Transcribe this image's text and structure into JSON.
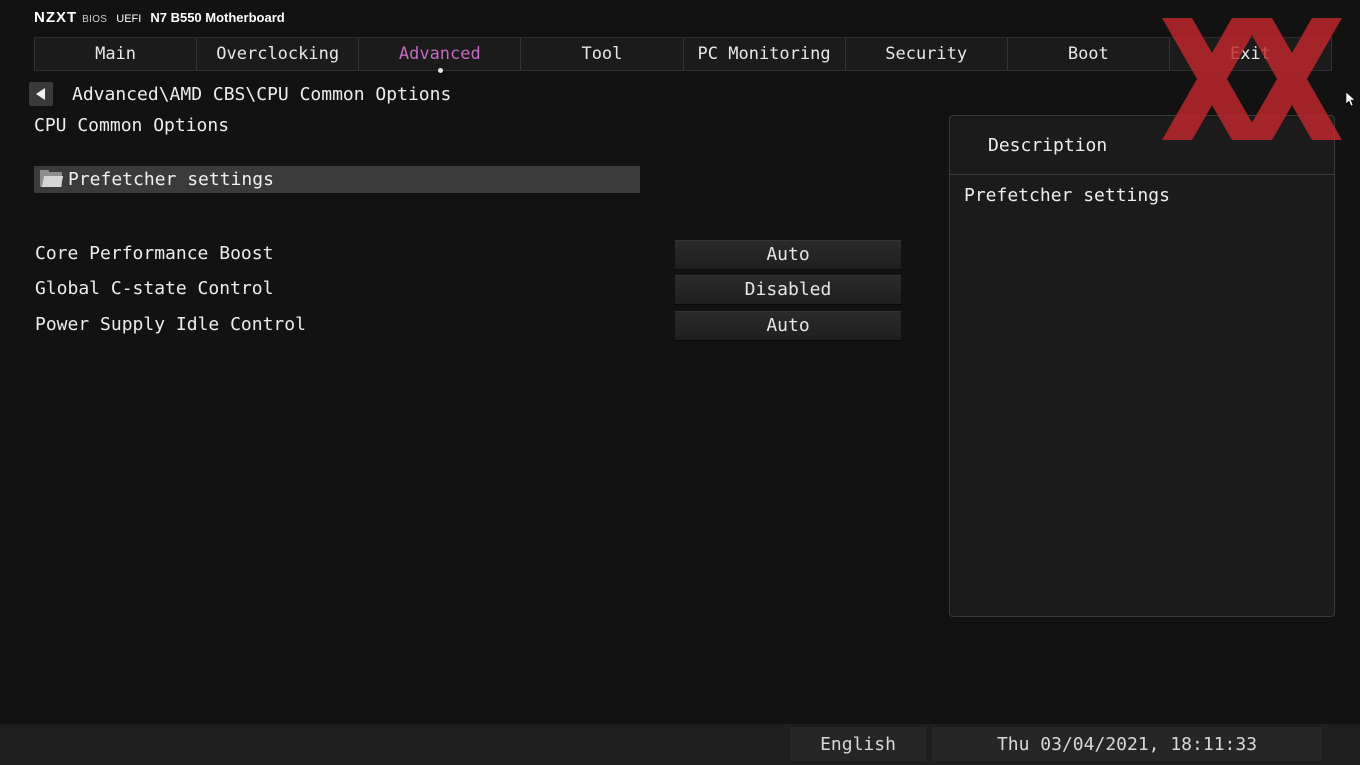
{
  "brand": {
    "logo": "NZXT",
    "bios": "BIOS",
    "uefi": "UEFI",
    "model": "N7 B550 Motherboard"
  },
  "tabs": [
    {
      "label": "Main"
    },
    {
      "label": "Overclocking"
    },
    {
      "label": "Advanced"
    },
    {
      "label": "Tool"
    },
    {
      "label": "PC Monitoring"
    },
    {
      "label": "Security"
    },
    {
      "label": "Boot"
    },
    {
      "label": "Exit"
    }
  ],
  "active_tab": "Advanced",
  "accent_color": "#c46ac4",
  "breadcrumb": "Advanced\\AMD CBS\\CPU Common Options",
  "page_title": "CPU Common Options",
  "submenu": {
    "label": "Prefetcher settings",
    "icon": "folder-icon"
  },
  "options": [
    {
      "label": "Core Performance Boost",
      "value": "Auto"
    },
    {
      "label": "Global C-state Control",
      "value": "Disabled"
    },
    {
      "label": "Power Supply Idle Control",
      "value": "Auto"
    }
  ],
  "description": {
    "title": "Description",
    "text": "Prefetcher settings"
  },
  "status": {
    "language": "English",
    "datetime": "Thu 03/04/2021, 18:11:33"
  }
}
